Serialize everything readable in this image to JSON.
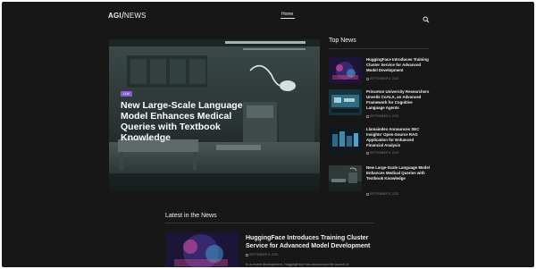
{
  "header": {
    "logo_part1": "AGI",
    "logo_part2": "NEWS",
    "nav_home": "Home",
    "search_icon": "search-icon"
  },
  "hero": {
    "badge": "LLM",
    "title": "New Large-Scale Language Model Enhances Medical Queries with Textbook Knowledge",
    "date": "SEPTEMBER 8, 2023"
  },
  "top_news": {
    "heading": "Top News",
    "items": [
      {
        "title": "HuggingFace Introduces Training Cluster Service for Advanced Model Development",
        "date": "SEPTEMBER 8, 2023"
      },
      {
        "title": "Princeton University Researchers Unveils CoALA, an Advanced Framework for Cognitive Language Agents",
        "date": "SEPTEMBER 8, 2023"
      },
      {
        "title": "Llamaindex Announces SEC Insights' Open-Source RAG Application for Enhanced Financial Analysis",
        "date": "SEPTEMBER 8, 2023"
      },
      {
        "title": "New Large-Scale Language Model Enhances Medical Queries with Textbook Knowledge",
        "date": "SEPTEMBER 8, 2023"
      }
    ]
  },
  "latest": {
    "heading": "Latest in the News",
    "title": "HuggingFace Introduces Training Cluster Service for Advanced Model Development",
    "date": "SEPTEMBER 8, 2023",
    "excerpt": "In a recent development, HuggingFace has announced the launch of"
  },
  "colors": {
    "background": "#171717",
    "badge": "#8a5cd6",
    "text": "#f2f2f2",
    "muted": "#7a7a7a"
  }
}
